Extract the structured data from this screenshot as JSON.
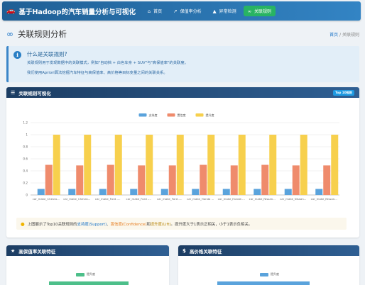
{
  "nav": {
    "brand": "基于Hadoop的汽车销量分析与可视化",
    "brand_icon": "car-icon",
    "links": [
      {
        "label": "首页",
        "icon": "home-icon"
      },
      {
        "label": "保值率分析",
        "icon": "chart-line-icon"
      },
      {
        "label": "异常检测",
        "icon": "warning-icon"
      },
      {
        "label": "关联规则",
        "icon": "link-icon"
      }
    ],
    "active_color": "#28b463"
  },
  "page": {
    "title": "关联规则分析",
    "title_icon": "link-icon",
    "breadcrumb": {
      "home": "首页",
      "sep": "/",
      "current": "关联规则"
    }
  },
  "info": {
    "heading": "什么是关联规则?",
    "line1": "关联规则用于发现数据中的关联模式，例如\"自动挡 + 白色车身 + SUV\"与\"高保值率\"的关联度。",
    "line2": "我们使用Apriori算法挖掘汽车特征与高保值率、高价格等目标变量之间的关联关系。"
  },
  "chart_panel": {
    "title": "关联规则可视化",
    "icon": "chart-bar-icon",
    "badge": "Top 10规则"
  },
  "chart_data": {
    "type": "bar",
    "categories": [
      "car_make_Chevro...",
      "car_make_Chevro...",
      "car_make_Ford -...",
      "car_make_Ford -...",
      "car_make_Ford -...",
      "car_make_Honda ...",
      "car_make_Honda ...",
      "car_make_Nissan...",
      "car_make_Nissan...",
      "car_make_Nissan..."
    ],
    "series": [
      {
        "name": "支持度",
        "color": "#5aa3dc",
        "values": [
          0.1,
          0.1,
          0.1,
          0.1,
          0.1,
          0.1,
          0.1,
          0.1,
          0.1,
          0.1
        ]
      },
      {
        "name": "置信度",
        "color": "#ef8b6c",
        "values": [
          0.5,
          0.49,
          0.5,
          0.49,
          0.49,
          0.5,
          0.49,
          0.5,
          0.49,
          0.49
        ]
      },
      {
        "name": "提升度",
        "color": "#f7d04d",
        "values": [
          1.0,
          1.0,
          1.0,
          1.0,
          1.0,
          1.0,
          1.0,
          1.0,
          1.0,
          1.0
        ]
      }
    ],
    "yticks": [
      "0",
      "0.2",
      "0.4",
      "0.6",
      "0.8",
      "1",
      "1.2"
    ],
    "ylim": [
      0,
      1.2
    ],
    "legend_position": "top-center",
    "grid": true
  },
  "tip": {
    "icon": "lightbulb-icon",
    "pre": "上图展示了Top10关联规则的",
    "support": "支持度(Support)",
    "sep1": "、",
    "confidence": "置信度(Confidence)",
    "sep2": "和",
    "lift": "提升度(Lift)",
    "post": "。提升度大于1表示正相关，小于1表示负相关。"
  },
  "panel_left": {
    "title": "高保值率关联特征",
    "icon": "star-icon",
    "legend": "提升度",
    "color": "#4dbf8a"
  },
  "panel_right": {
    "title": "高价格关联特征",
    "icon": "dollar-icon",
    "legend": "提升度",
    "color": "#5aa3dc"
  }
}
